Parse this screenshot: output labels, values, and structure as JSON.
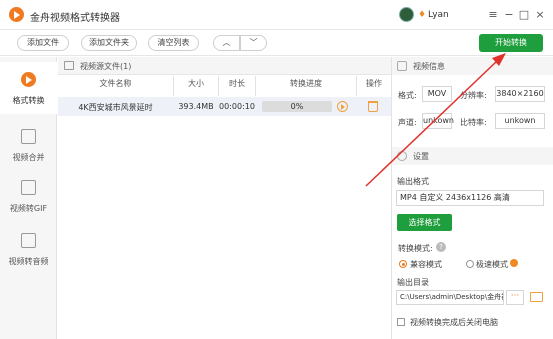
{
  "window": {
    "title": "金舟视频格式转换器",
    "username": "Lyan",
    "controls": {
      "menu": "≡",
      "minimize": "−",
      "maximize": "□",
      "close": "×"
    }
  },
  "toolbar": {
    "add_file": "添加文件",
    "add_folder": "添加文件夹",
    "clear_list": "清空列表",
    "up": "︿",
    "down": "﹀",
    "start": "开始转换"
  },
  "sidebar": {
    "items": [
      {
        "label": "格式转换",
        "icon": "play-icon",
        "active": true
      },
      {
        "label": "视频合并",
        "icon": "merge-icon",
        "active": false
      },
      {
        "label": "视频转GIF",
        "icon": "image-icon",
        "active": false
      },
      {
        "label": "视频转音频",
        "icon": "music-icon",
        "active": false
      }
    ]
  },
  "file_list": {
    "title": "视频源文件(1)",
    "columns": [
      "文件名称",
      "大小",
      "时长",
      "转换进度",
      "操作"
    ],
    "rows": [
      {
        "name": "4K西安城市风景延时",
        "size": "393.4MB",
        "duration": "00:00:10",
        "progress": "0%"
      }
    ]
  },
  "video_info": {
    "title": "视频信息",
    "format_label": "格式:",
    "format_value": "MOV",
    "resolution_label": "分辨率:",
    "resolution_value": "3840×2160",
    "channel_label": "声道:",
    "channel_value": "unkown",
    "bitrate_label": "比特率:",
    "bitrate_value": "unkown"
  },
  "settings": {
    "title": "设置",
    "output_format_label": "输出格式",
    "output_format_value": "MP4 自定义 2436x1126 高清",
    "select_format_button": "选择格式",
    "mode_label": "转换模式:",
    "mode_compatible": "兼容模式",
    "mode_fast": "极速模式",
    "output_dir_label": "输出目录",
    "output_dir_value": "C:\\Users\\admin\\Desktop\\金舟视",
    "browse": "···",
    "shutdown_label": "视频转换完成后关闭电脑"
  },
  "colors": {
    "accent_green": "#1e9e3c",
    "accent_orange": "#f07a1f",
    "arrow_red": "#e0312b"
  }
}
